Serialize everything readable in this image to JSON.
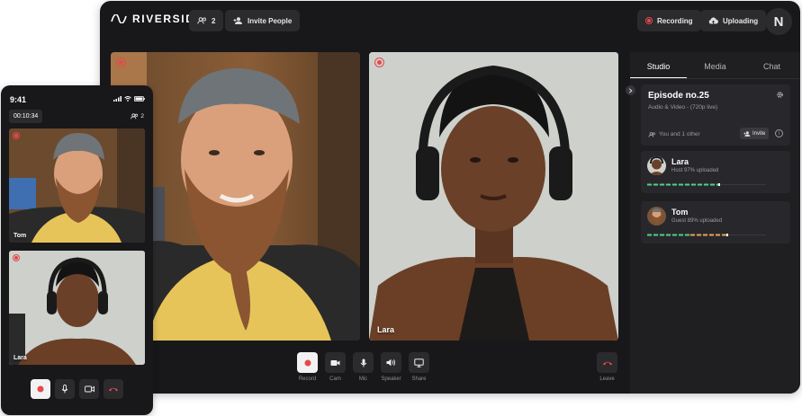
{
  "topbar": {
    "logo": "RIVERSIDE",
    "participants_count": "2",
    "invite_label": "Invite People",
    "recording_label": "Recording",
    "uploading_label": "Uploading",
    "avatar_initial": "N"
  },
  "videos": [
    {
      "name": ""
    },
    {
      "name": "Lara"
    }
  ],
  "controls": {
    "record": "Record",
    "cam": "Cam",
    "mic": "Mic",
    "speaker": "Speaker",
    "share": "Share",
    "leave": "Leave"
  },
  "panel": {
    "tabs": [
      "Studio",
      "Media",
      "Chat"
    ],
    "active_tab": "Studio",
    "episode": {
      "title": "Episode no.25",
      "subtitle": "Audio & Video - (720p live)",
      "participants": "You and 1 other",
      "invite_label": "Invite"
    },
    "guests": [
      {
        "name": "Lara",
        "status": "Host  97% uploaded",
        "progress": 0.6
      },
      {
        "name": "Tom",
        "status": "Guest  89% uploaded",
        "progress": 0.67
      }
    ]
  },
  "colors": {
    "accent_red": "#e5484d",
    "progress_green": "#4fd18b",
    "progress_orange": "#e8a15a",
    "window_bg": "#18181a"
  },
  "phone": {
    "time": "9:41",
    "timer": "00:10:34",
    "participants_count": "2",
    "videos": [
      {
        "name": "Tom"
      },
      {
        "name": "Lara"
      }
    ]
  }
}
